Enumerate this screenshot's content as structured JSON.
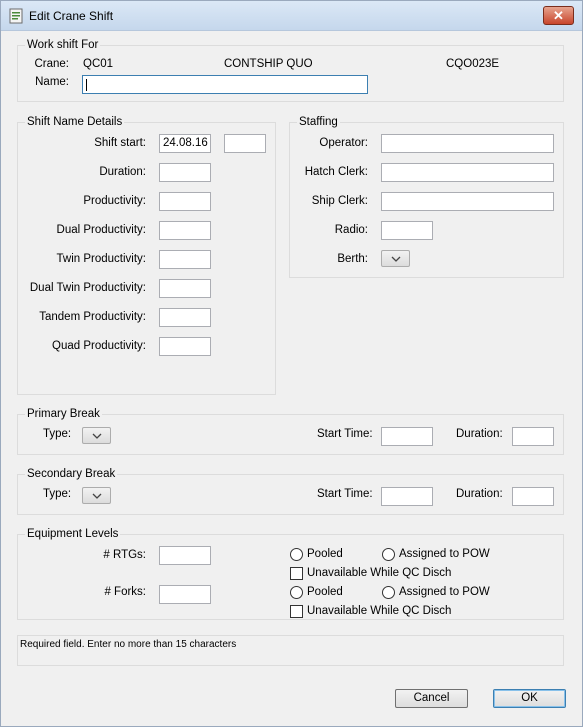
{
  "window": {
    "title": "Edit Crane Shift",
    "close_label": "✕"
  },
  "work_shift": {
    "group_label": "Work shift For",
    "crane_label": "Crane:",
    "crane_id": "QC01",
    "vessel": "CONTSHIP QUO",
    "vessel_code": "CQO023E",
    "name_label": "Name:",
    "name_value": ""
  },
  "shift_name_details": {
    "group_label": "Shift Name Details",
    "shift_start_label": "Shift start:",
    "shift_start_date": "24.08.16",
    "shift_start_time": "",
    "duration_label": "Duration:",
    "productivity_label": "Productivity:",
    "dual_productivity_label": "Dual Productivity:",
    "twin_productivity_label": "Twin Productivity:",
    "dual_twin_productivity_label": "Dual Twin Productivity:",
    "tandem_productivity_label": "Tandem Productivity:",
    "quad_productivity_label": "Quad Productivity:"
  },
  "staffing": {
    "group_label": "Staffing",
    "operator_label": "Operator:",
    "hatch_clerk_label": "Hatch Clerk:",
    "ship_clerk_label": "Ship Clerk:",
    "radio_label": "Radio:",
    "berth_label": "Berth:"
  },
  "primary_break": {
    "group_label": "Primary Break",
    "type_label": "Type:",
    "start_time_label": "Start Time:",
    "duration_label": "Duration:"
  },
  "secondary_break": {
    "group_label": "Secondary Break",
    "type_label": "Type:",
    "start_time_label": "Start Time:",
    "duration_label": "Duration:"
  },
  "equipment": {
    "group_label": "Equipment Levels",
    "rtgs_label": "# RTGs:",
    "forks_label": "# Forks:",
    "pooled_label": "Pooled",
    "assigned_label": "Assigned to POW",
    "unavailable_label": "Unavailable While QC Disch"
  },
  "status_message": "Required field. Enter no more than 15 characters",
  "buttons": {
    "cancel": "Cancel",
    "ok": "OK"
  }
}
